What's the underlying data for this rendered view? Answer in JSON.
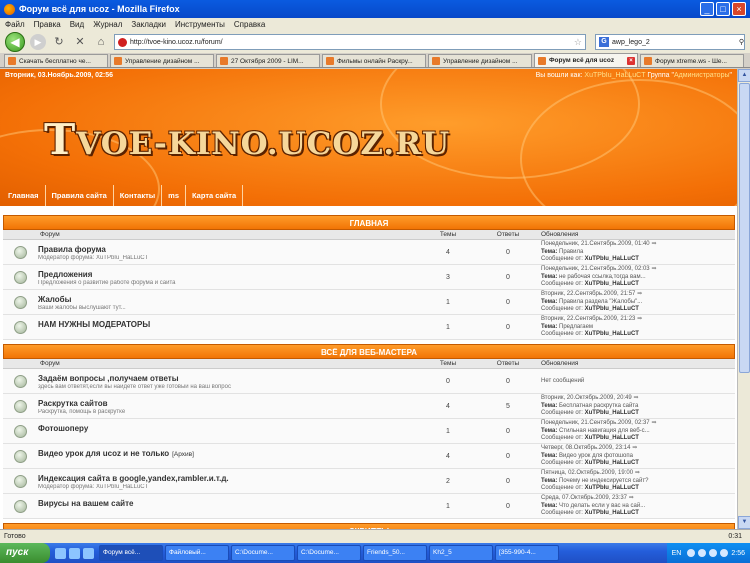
{
  "browser": {
    "window_title": "Форум всё для ucoz - Mozilla Firefox",
    "menu": [
      "Файл",
      "Правка",
      "Вид",
      "Журнал",
      "Закладки",
      "Инструменты",
      "Справка"
    ],
    "url": "http://tvoe-kino.ucoz.ru/forum/",
    "search_query": "awp_lego_2",
    "search_engine_icon": "G",
    "tabs": [
      {
        "label": "Скачать бесплатно че...",
        "active": false
      },
      {
        "label": "Управление дизайном ...",
        "active": false
      },
      {
        "label": "27 Октября 2009 - LIM...",
        "active": false
      },
      {
        "label": "Фильмы онлайн Раскру...",
        "active": false
      },
      {
        "label": "Управление дизайном ...",
        "active": false
      },
      {
        "label": "Форум всё для ucoz",
        "active": true
      },
      {
        "label": "Форум xtreme.ws - Ше...",
        "active": false
      }
    ],
    "status_text": "Готово",
    "status_time": "0:31"
  },
  "site": {
    "date": "Вторник, 03.Ноябрь.2009, 02:56",
    "user_prefix": "Вы вошли как",
    "username": "XuTPbIu_HaLLuCT",
    "group_prefix": "Группа",
    "group": "Администраторы",
    "logo_first": "T",
    "logo_rest": "VOE-KINO.UCOZ.RU",
    "nav": [
      "Главная",
      "Правила сайта",
      "Контакты",
      "ms",
      "Карта сайта"
    ]
  },
  "forum": {
    "columns": {
      "forum": "Форум",
      "topics": "Темы",
      "posts": "Ответы",
      "updates": "Обновления"
    },
    "last_labels": {
      "topic": "Тема:",
      "by": "Сообщение от:"
    },
    "categories": [
      {
        "title": "ГЛАВНАЯ",
        "forums": [
          {
            "name": "Правила форума",
            "sub": "Модератор форума: XuTPbIu_HaLLuCT",
            "topics": "4",
            "posts": "0",
            "last_date": "Понедельник, 21.Сентябрь.2009, 01:40",
            "last_topic": "Правила",
            "last_by": "XuTPbIu_HaLLuCT"
          },
          {
            "name": "Предложения",
            "sub": "Предложения о развитие работе форума и сайта",
            "topics": "3",
            "posts": "0",
            "last_date": "Понедельник, 21.Сентябрь.2009, 02:03",
            "last_topic": "не рабочая ссылка,тогда вам...",
            "last_by": "XuTPbIu_HaLLuCT"
          },
          {
            "name": "Жалобы",
            "sub": "Ваши жалобы выслушают тут...",
            "topics": "1",
            "posts": "0",
            "last_date": "Вторник, 22.Сентябрь.2009, 21:57",
            "last_topic": "Правила раздела \"Жалобы\"...",
            "last_by": "XuTPbIu_HaLLuCT"
          },
          {
            "name": "НАМ НУЖНЫ МОДЕРАТОРЫ",
            "sub": "",
            "topics": "1",
            "posts": "0",
            "last_date": "Вторник, 22.Сентябрь.2009, 21:23",
            "last_topic": "Предлагаем",
            "last_by": "XuTPbIu_HaLLuCT"
          }
        ]
      },
      {
        "title": "ВСЁ ДЛЯ ВЕБ-МАСТЕРА",
        "forums": [
          {
            "name": "Задаём вопросы ,получаем ответы",
            "sub": "здесь вам ответят,если вы найдете ответ уже готовый на ваш вопрос",
            "topics": "0",
            "posts": "0",
            "last_none": "Нет сообщений"
          },
          {
            "name": "Раскрутка сайтов",
            "sub": "Раскрутка, помощь в раскрутке",
            "topics": "4",
            "posts": "5",
            "last_date": "Вторник, 20.Октябрь.2009, 20:49",
            "last_topic": "Бесплатная раскрутка сайта",
            "last_by": "XuTPbIu_HaLLuCT"
          },
          {
            "name": "Фотошоперу",
            "sub": "",
            "topics": "1",
            "posts": "0",
            "last_date": "Понедельник, 21.Сентябрь.2009, 02:37",
            "last_topic": "Стильная навигация для веб-с...",
            "last_by": "XuTPbIu_HaLLuCT"
          },
          {
            "name": "Видео урок для ucoz и не только",
            "name_tag": "[Архив]",
            "sub": "",
            "topics": "4",
            "posts": "0",
            "last_date": "Четверг, 08.Октябрь.2009, 23:14",
            "last_topic": "Видео урок для фотошопа",
            "last_by": "XuTPbIu_HaLLuCT"
          },
          {
            "name": "Индексация сайта в google,yandex,rambler.и.т.д.",
            "sub": "Модератор форума: XuTPbIu_HaLLuCT",
            "topics": "2",
            "posts": "0",
            "last_date": "Пятница, 02.Октябрь.2009, 19:00",
            "last_topic": "Почему не индексируется сайт?",
            "last_by": "XuTPbIu_HaLLuCT"
          },
          {
            "name": "Вирусы на вашем сайте",
            "sub": "",
            "topics": "1",
            "posts": "0",
            "last_date": "Среда, 07.Октябрь.2009, 23:37",
            "last_topic": "Что делать если у вас на сай...",
            "last_by": "XuTPbIu_HaLLuCT"
          }
        ]
      },
      {
        "title": "СКРИПТЫ",
        "forums": []
      }
    ]
  },
  "taskbar": {
    "start_label": "пуск",
    "windows": [
      "Форум всё...",
      "Файловый...",
      "C:\\Docume...",
      "C:\\Docume...",
      "Friends_50...",
      "Kh2_5",
      "[355-990-4..."
    ],
    "active_index": 0,
    "lang": "EN",
    "clock": "2:56"
  }
}
